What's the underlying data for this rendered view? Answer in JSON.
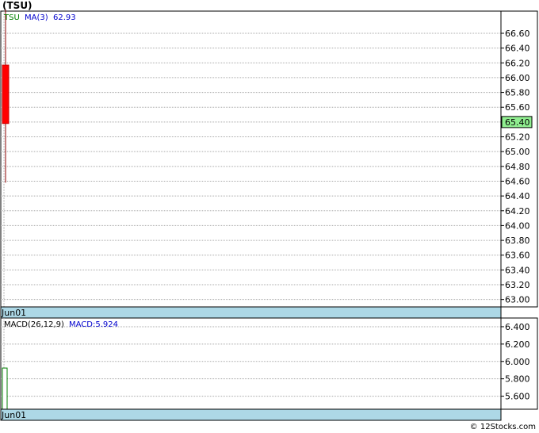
{
  "title": "(TSU)",
  "copyright": "© 12Stocks.com",
  "colors": {
    "grid": "#aaaaaa",
    "date_band": "#add8e6",
    "candle_down": "#ff0000",
    "wick": "#8b0000",
    "macd_bar": "#008000",
    "price_tag": "#90ee90",
    "ticker_label": "#008000",
    "ma_label": "#0000cd"
  },
  "chart_data": [
    {
      "type": "candlestick",
      "legend": {
        "ticker": "TSU",
        "ma_label": "MA(3)",
        "ma_value": "62.93"
      },
      "ylim": [
        62.9,
        66.9
      ],
      "y_ticks": [
        "63.00",
        "63.20",
        "63.40",
        "63.60",
        "63.80",
        "64.00",
        "64.20",
        "64.40",
        "64.60",
        "64.80",
        "65.00",
        "65.20",
        "65.40",
        "65.60",
        "65.80",
        "66.00",
        "66.20",
        "66.40",
        "66.60"
      ],
      "x_labels": [
        "Jun01"
      ],
      "candles": [
        {
          "date": "Jun01",
          "open": 66.17,
          "high": 66.92,
          "low": 64.58,
          "close": 65.38
        }
      ],
      "last_price": "65.40"
    },
    {
      "type": "bar",
      "legend": {
        "label": "MACD(26,12,9)",
        "value_label": "MACD:5.924"
      },
      "ylim": [
        5.45,
        6.5
      ],
      "y_ticks": [
        "5.600",
        "5.800",
        "6.000",
        "6.200",
        "6.400"
      ],
      "x_labels": [
        "Jun01"
      ],
      "values": [
        5.924
      ]
    }
  ]
}
